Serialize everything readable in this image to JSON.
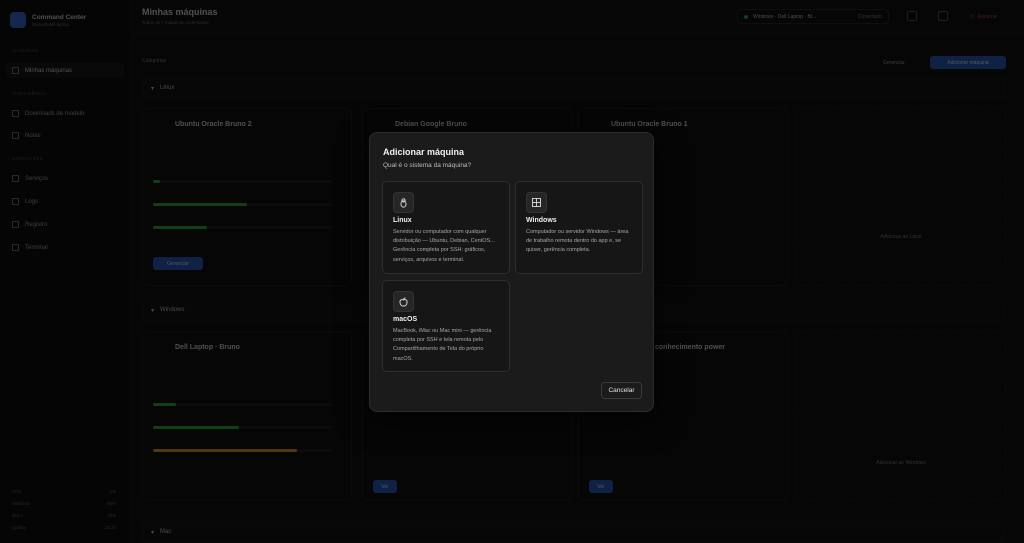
{
  "sidebar": {
    "brand_title": "Command Center",
    "brand_sub": "bruno@dell-laptop",
    "section_main": "MÁQUINAS",
    "item_machines": "Minhas máquinas",
    "section_ai": "INTELIGÊNCIA",
    "item_downloads": "Downloads de modelo",
    "item_notes": "Notas",
    "section_ops": "OPERAÇÕES",
    "item_services": "Serviços",
    "item_logs": "Logs",
    "item_registry": "Registro",
    "item_terminal": "Terminal",
    "stats": [
      {
        "label": "CPU",
        "value": "4%"
      },
      {
        "label": "Memória",
        "value": "68%"
      },
      {
        "label": "Disco",
        "value": "76%"
      },
      {
        "label": "Uptime",
        "value": "3d 2h"
      }
    ]
  },
  "header": {
    "title": "Minhas máquinas",
    "subtitle": "Todas as 7 máquinas conectadas",
    "host": "Windows · Dell Laptop · Br...",
    "host_status": "Conectado",
    "exit": "Encerrar"
  },
  "toolbar": {
    "filter": "Categorias",
    "manage": "Gerenciar",
    "add": "Adicionar máquina"
  },
  "groups": {
    "linux": "Linux",
    "windows": "Windows",
    "mac": "Mac"
  },
  "cards": {
    "c1_title": "Ubuntu Oracle Bruno 2",
    "c1_btn": "Gerenciar",
    "c2_title": "Debian Google Bruno",
    "c3_title": "Ubuntu Oracle Bruno 1",
    "c4_title": "Dell Laptop · Bruno",
    "c4_btn": "Ver",
    "c5_title": "conhecimento power",
    "add_linux": "Adicionar ao Linux",
    "add_windows": "Adicionar ao Windows"
  },
  "levels": {
    "c1": [
      0.04,
      0.52,
      0.3
    ],
    "c4": [
      0.13,
      0.48,
      0.8
    ]
  },
  "modal": {
    "title": "Adicionar máquina",
    "subtitle": "Qual é o sistema da máquina?",
    "options": [
      {
        "icon": "linux-icon",
        "title": "Linux",
        "desc": "Servidor ou computador com qualquer distribuição — Ubuntu, Debian, CentOS... Gerência completa por SSH: gráficos, serviços, arquivos e terminal."
      },
      {
        "icon": "windows-icon",
        "title": "Windows",
        "desc": "Computador ou servidor Windows — área de trabalho remota dentro do app e, se quiser, gerência completa."
      },
      {
        "icon": "apple-icon",
        "title": "macOS",
        "desc": "MacBook, iMac ou Mac mini — gerência completa por SSH e tela remota pelo Compartilhamento de Tela do próprio macOS."
      }
    ],
    "cancel": "Cancelar"
  }
}
